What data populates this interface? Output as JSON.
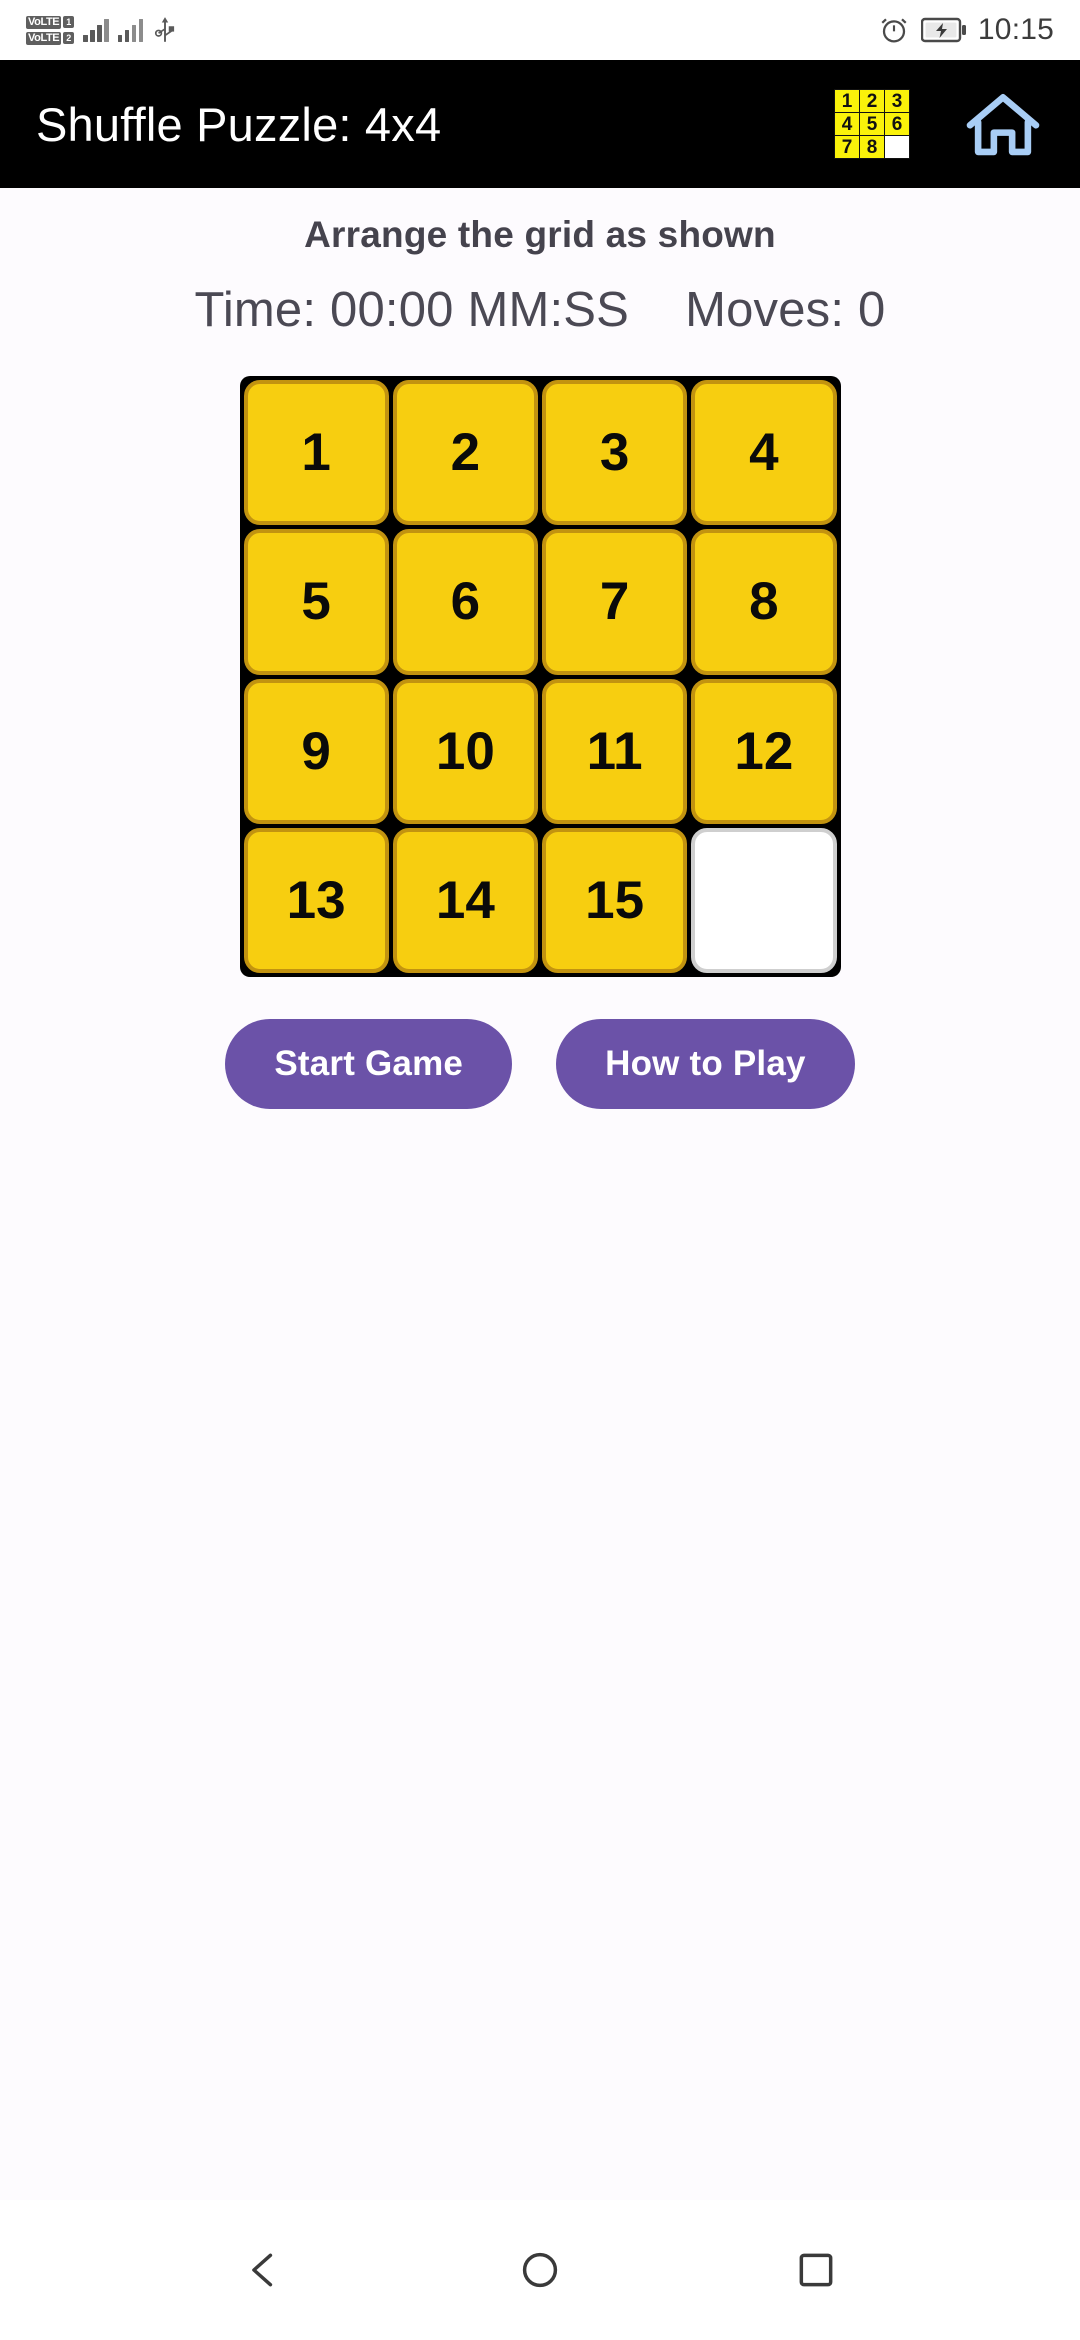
{
  "status_bar": {
    "volte_1_label": "VoLTE",
    "volte_1_sim": "1",
    "volte_2_label": "VoLTE",
    "volte_2_sim": "2",
    "usb_icon": "usb-icon",
    "alarm_icon": "alarm-clock-icon",
    "battery_icon": "battery-charging-icon",
    "time": "10:15"
  },
  "app_bar": {
    "title": "Shuffle Puzzle: 4x4",
    "app_icon_name": "puzzle-grid-icon",
    "app_icon_cells": [
      "1",
      "2",
      "3",
      "4",
      "5",
      "6",
      "7",
      "8",
      ""
    ],
    "home_icon_name": "home-icon",
    "background": "#000000",
    "title_color": "#FFFFFF",
    "home_icon_color": "#A8CDF5"
  },
  "main": {
    "subtitle": "Arrange the grid as shown",
    "time_label": "Time: 00:00 MM:SS",
    "moves_label": "Moves: 0"
  },
  "board": {
    "rows": 4,
    "columns": 4,
    "tiles": [
      "1",
      "2",
      "3",
      "4",
      "5",
      "6",
      "7",
      "8",
      "9",
      "10",
      "11",
      "12",
      "13",
      "14",
      "15",
      ""
    ],
    "blank_index": 15,
    "tile_color": "#F7CE10",
    "tile_border_color": "#C29310",
    "blank_color": "#FFFFFF",
    "board_background": "#000000"
  },
  "buttons": {
    "start_game": "Start Game",
    "how_to_play": "How to Play",
    "color": "#6B52A8",
    "text_color": "#FFFFFF"
  },
  "nav_bar": {
    "back_icon": "back-triangle-icon",
    "home_icon": "home-circle-icon",
    "recents_icon": "recents-square-icon"
  }
}
